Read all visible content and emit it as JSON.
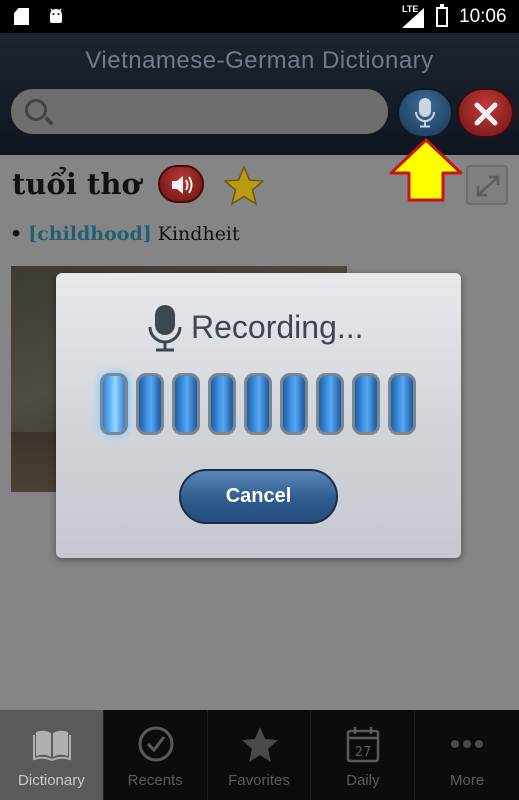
{
  "status_bar": {
    "network": "LTE",
    "time": "10:06"
  },
  "header": {
    "title": "Vietnamese-German Dictionary",
    "search": {
      "value": "",
      "placeholder": ""
    }
  },
  "entry": {
    "word": "tuổi thơ",
    "definition": {
      "bullet": "•",
      "tag": "[childhood]",
      "translation": "Kindheit"
    }
  },
  "dialog": {
    "title": "Recording...",
    "cancel_label": "Cancel",
    "level_bars": 9,
    "active_bars": 1
  },
  "bottom_nav": {
    "items": [
      {
        "label": "Dictionary",
        "icon": "book-icon",
        "active": true
      },
      {
        "label": "Recents",
        "icon": "clock-icon",
        "active": false
      },
      {
        "label": "Favorites",
        "icon": "star-icon",
        "active": false
      },
      {
        "label": "Daily",
        "icon": "calendar-icon",
        "active": false,
        "badge": "27"
      },
      {
        "label": "More",
        "icon": "more-icon",
        "active": false
      }
    ]
  },
  "colors": {
    "header_bg": "#131b26",
    "arrow": "#ffff00",
    "cancel_button": "#3a6799",
    "close_button": "#a62a2a"
  }
}
